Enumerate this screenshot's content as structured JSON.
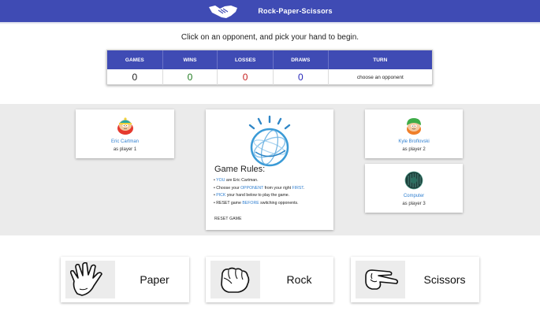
{
  "header": {
    "title": "Rock-Paper-Scissors",
    "logo_icon": "handshake-icon",
    "color": "#3f4bb4"
  },
  "instruction": "Click on an opponent, and pick your hand to begin.",
  "stats": {
    "headers": [
      "GAMES",
      "WINS",
      "LOSSES",
      "DRAWS",
      "TURN"
    ],
    "values": {
      "games": "0",
      "wins": "0",
      "losses": "0",
      "draws": "0",
      "turn": "choose an opponent"
    }
  },
  "players": {
    "you": {
      "name": "Eric Cartman",
      "role": "as player 1",
      "avatar_icon": "cartman-avatar-icon"
    },
    "opponent1": {
      "name": "Kyle Broflovski",
      "role": "as player 2",
      "avatar_icon": "kyle-avatar-icon"
    },
    "opponent2": {
      "name": "Computer",
      "role": "as player 3",
      "avatar_icon": "computer-avatar-icon"
    }
  },
  "rules": {
    "title": "Game Rules:",
    "items": [
      {
        "a": "YOU",
        "b": " are Eric Cartman."
      },
      {
        "pre": "Choose your ",
        "a": "OPPONENT",
        "mid": " from your right ",
        "c": "FIRST",
        "post": "."
      },
      {
        "a": "PICK",
        "b": " your hand below to play the game."
      },
      {
        "pre": "RESET game ",
        "a": "BEFORE",
        "b": " switching opponents."
      }
    ],
    "reset_label": "RESET GAME"
  },
  "hands": [
    {
      "label": "Paper",
      "icon": "paper-hand-icon"
    },
    {
      "label": "Rock",
      "icon": "rock-hand-icon"
    },
    {
      "label": "Scissors",
      "icon": "scissors-hand-icon"
    }
  ]
}
